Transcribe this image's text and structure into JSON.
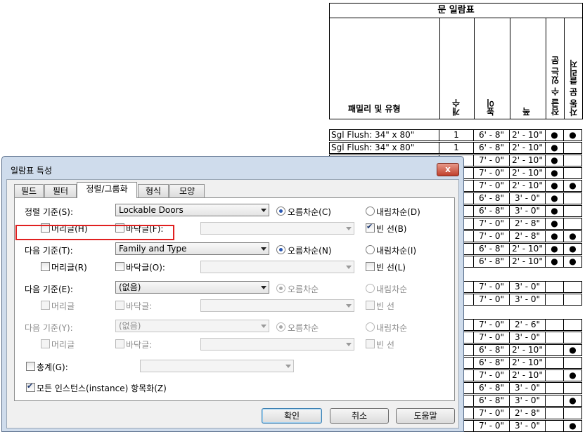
{
  "schedule": {
    "title": "문 일람표",
    "headers": {
      "family": "패밀리 및 유형",
      "count": "개수",
      "height": "높이",
      "width": "폭",
      "lockable": "잠글 수 있는 문",
      "auto_closer": "자동 문 클리저"
    },
    "rows": [
      {
        "name": "Sgl Flush: 34\" x 80\"",
        "count": "1",
        "height": "6' - 8\"",
        "width": "2' - 10\"",
        "lock": "●",
        "auto": "●"
      },
      {
        "name": "Sgl Flush: 34\" x 80\"",
        "count": "1",
        "height": "6' - 8\"",
        "width": "2' - 10\"",
        "lock": "●",
        "auto": ""
      },
      {
        "name": "",
        "count": "",
        "height": "7' - 0\"",
        "width": "2' - 10\"",
        "lock": "●",
        "auto": ""
      },
      {
        "name": "",
        "count": "",
        "height": "7' - 0\"",
        "width": "2' - 10\"",
        "lock": "●",
        "auto": ""
      },
      {
        "name": "",
        "count": "",
        "height": "7' - 0\"",
        "width": "2' - 10\"",
        "lock": "●",
        "auto": "●"
      },
      {
        "name": "",
        "count": "",
        "height": "6' - 8\"",
        "width": "3' - 0\"",
        "lock": "●",
        "auto": ""
      },
      {
        "name": "",
        "count": "",
        "height": "6' - 8\"",
        "width": "3' - 0\"",
        "lock": "●",
        "auto": ""
      },
      {
        "name": "",
        "count": "",
        "height": "7' - 0\"",
        "width": "2' - 8\"",
        "lock": "●",
        "auto": ""
      },
      {
        "name": "",
        "count": "",
        "height": "7' - 0\"",
        "width": "2' - 8\"",
        "lock": "●",
        "auto": "●"
      },
      {
        "name": "",
        "count": "",
        "height": "6' - 8\"",
        "width": "2' - 10\"",
        "lock": "●",
        "auto": "●"
      },
      {
        "name": "",
        "count": "",
        "height": "6' - 8\"",
        "width": "2' - 10\"",
        "lock": "●",
        "auto": "●"
      },
      {
        "name": "",
        "count": "",
        "height": "7' - 0\"",
        "width": "3' - 0\"",
        "lock": "",
        "auto": ""
      },
      {
        "name": "",
        "count": "",
        "height": "7' - 0\"",
        "width": "3' - 0\"",
        "lock": "",
        "auto": ""
      },
      {
        "name": "",
        "count": "",
        "height": "7' - 0\"",
        "width": "2' - 6\"",
        "lock": "",
        "auto": ""
      },
      {
        "name": "",
        "count": "",
        "height": "7' - 0\"",
        "width": "3' - 0\"",
        "lock": "",
        "auto": ""
      },
      {
        "name": "",
        "count": "",
        "height": "6' - 8\"",
        "width": "2' - 10\"",
        "lock": "",
        "auto": "●"
      },
      {
        "name": "",
        "count": "",
        "height": "6' - 8\"",
        "width": "2' - 10\"",
        "lock": "",
        "auto": ""
      },
      {
        "name": "",
        "count": "",
        "height": "7' - 0\"",
        "width": "2' - 10\"",
        "lock": "",
        "auto": "●"
      },
      {
        "name": "",
        "count": "",
        "height": "6' - 8\"",
        "width": "3' - 0\"",
        "lock": "",
        "auto": ""
      },
      {
        "name": "",
        "count": "",
        "height": "6' - 8\"",
        "width": "3' - 0\"",
        "lock": "",
        "auto": "●"
      },
      {
        "name": "",
        "count": "",
        "height": "7' - 0\"",
        "width": "2' - 8\"",
        "lock": "",
        "auto": ""
      },
      {
        "name": "",
        "count": "",
        "height": "7' - 0\"",
        "width": "3' - 0\"",
        "lock": "",
        "auto": "●"
      }
    ]
  },
  "dialog": {
    "title": "일람표 특성",
    "close": "x",
    "tabs": [
      "필드",
      "필터",
      "정렬/그룹화",
      "형식",
      "모양"
    ],
    "sort1": {
      "label": "정렬 기준(S):",
      "value": "Lockable Doors",
      "asc": "오름차순(C)",
      "desc": "내림차순(D)",
      "header": "머리글(H)",
      "footer": "바닥글(F):",
      "blank": "빈 선(B)"
    },
    "sort2": {
      "label": "다음 기준(T):",
      "value": "Family and Type",
      "asc": "오름차순(N)",
      "desc": "내림차순(I)",
      "header": "머리글(R)",
      "footer": "바닥글(O):",
      "blank": "빈 선(L)"
    },
    "sort3": {
      "label": "다음 기준(E):",
      "value": "(없음)",
      "asc": "오름차순",
      "desc": "내림차순",
      "header": "머리글",
      "footer": "바닥글:",
      "blank": "빈 선"
    },
    "sort4": {
      "label": "다음 기준(Y):",
      "value": "(없음)",
      "asc": "오름차순",
      "desc": "내림차순",
      "header": "머리글",
      "footer": "바닥글:",
      "blank": "빈 선"
    },
    "grand_total": "총계(G):",
    "itemize": "모든 인스턴스(instance) 항목화(Z)",
    "ok": "확인",
    "cancel": "취소",
    "help": "도움말"
  }
}
